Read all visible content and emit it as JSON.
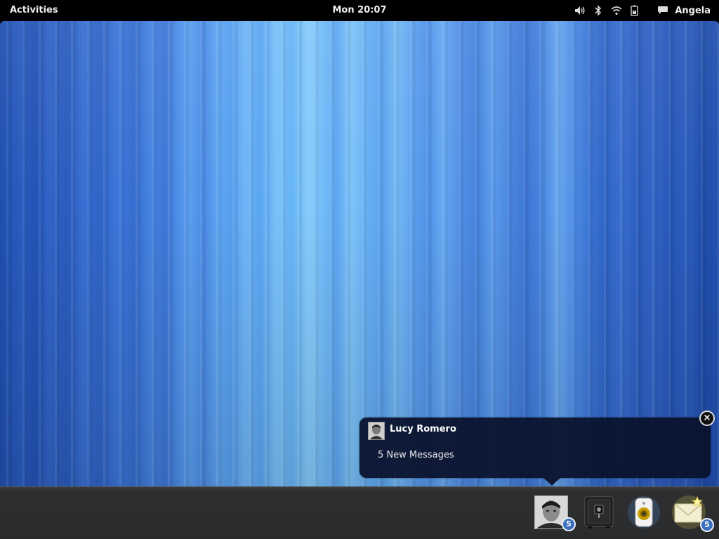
{
  "topbar": {
    "activities_label": "Activities",
    "clock": "Mon 20:07",
    "user_name": "Angela",
    "status_icons": [
      "volume-icon",
      "bluetooth-icon",
      "wifi-icon",
      "battery-icon",
      "chat-icon"
    ]
  },
  "notification": {
    "title": "Lucy Romero",
    "body": "5 New Messages",
    "close_glyph": "×"
  },
  "tray": {
    "items": [
      {
        "name": "contact-lucy-romero",
        "badge": "5"
      },
      {
        "name": "safe-app",
        "badge": ""
      },
      {
        "name": "music-player",
        "badge": ""
      },
      {
        "name": "mail-app",
        "badge": "5"
      }
    ]
  },
  "colors": {
    "accent_badge": "#3a6fbf",
    "notification_bg": "#0a122d",
    "topbar_bg": "#000000",
    "tray_bg": "#2a2b2c"
  }
}
